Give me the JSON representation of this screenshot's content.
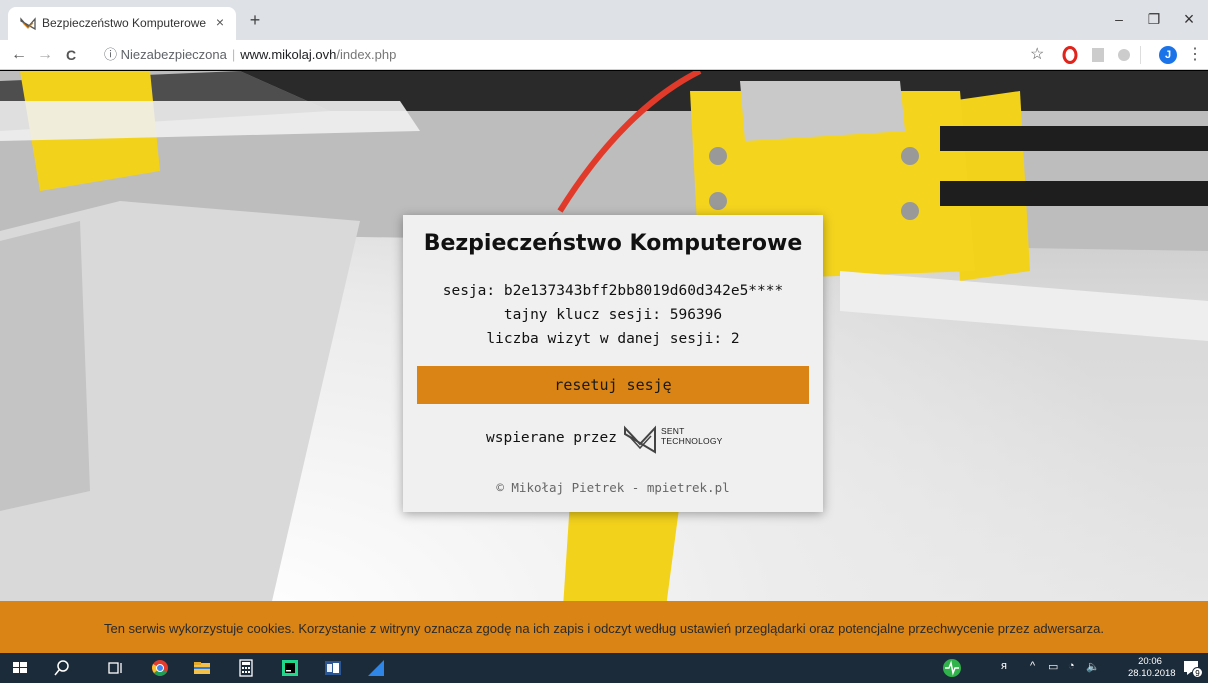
{
  "browser": {
    "tab_title": "Bezpieczeństwo Komputerowe",
    "tab_close": "×",
    "new_tab": "+",
    "security_label": "Niezabezpieczona",
    "url_host": "www.mikolaj.ovh",
    "url_path": "/index.php",
    "profile_initial": "J",
    "window_controls": {
      "minimize": "–",
      "restore": "❐",
      "close": "×"
    },
    "nav": {
      "back": "←",
      "forward": "→",
      "reload": "C",
      "menu": "⋮"
    }
  },
  "card": {
    "title": "Bezpieczeństwo Komputerowe",
    "session_line": "sesja: b2e137343bff2bb8019d60d342e5****",
    "secret_line": "tajny klucz sesji: 596396",
    "visits_line": "liczba wizyt w danej sesji: 2",
    "reset_label": "resetuj sesję",
    "sponsor_label": "wspierane przez",
    "sponsor_brand_1": "SENT",
    "sponsor_brand_2": "TECHNOLOGY",
    "copyright": "© Mikołaj Pietrek - mpietrek.pl"
  },
  "cookie_bar": {
    "text": "Ten serwis wykorzystuje cookies. Korzystanie z witryny oznacza zgodę na ich zapis i odczyt według ustawień przeglądarki oraz potencjalne przechwycenie przez adwersarza."
  },
  "taskbar": {
    "time": "20:06",
    "date": "28.10.2018",
    "notifications": "9"
  },
  "colors": {
    "accent": "#d98415",
    "card_bg": "#f0f0f0",
    "taskbar": "#1c2b3a",
    "tabbar": "#dee1e6"
  }
}
